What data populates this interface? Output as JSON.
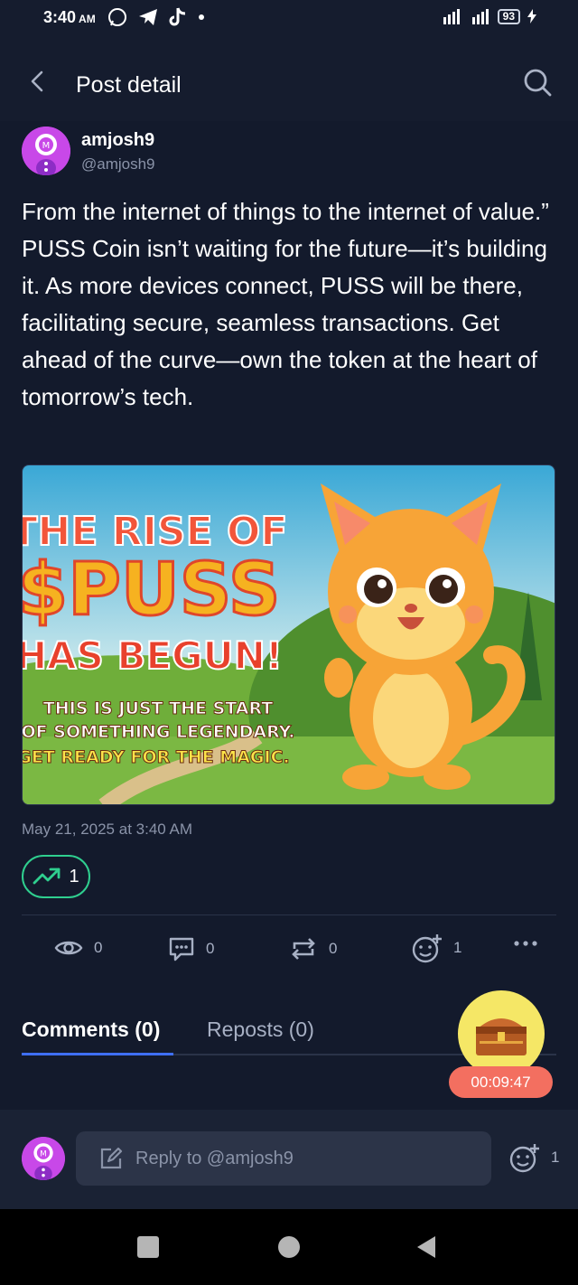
{
  "status_bar": {
    "time": "3:40",
    "ampm": "AM",
    "battery": "93",
    "network": "LTE"
  },
  "header": {
    "title": "Post detail"
  },
  "post": {
    "author_name": "amjosh9",
    "author_handle": "@amjosh9",
    "body": "From the internet of things to the internet of value.” PUSS Coin isn’t waiting for the future—it’s building it. As more devices connect, PUSS will be there, facilitating secure, seamless transactions. Get ahead of the curve—own the token at the heart of tomorrow’s tech.",
    "image": {
      "line1": "THE RISE OF",
      "line2": "$PUSS",
      "line3": "HAS BEGUN!",
      "sub1": "THIS IS JUST THE START",
      "sub2": "OF SOMETHING LEGENDARY.",
      "sub3": "GET READY FOR THE MAGIC."
    },
    "date": "May 21, 2025 at 3:40 AM",
    "trend_count": "1",
    "stats": {
      "views": "0",
      "comments": "0",
      "reposts": "0",
      "reactions": "1"
    }
  },
  "tabs": [
    {
      "label": "Comments (0)"
    },
    {
      "label": "Reposts (0)"
    }
  ],
  "reward_timer": "00:09:47",
  "reply": {
    "placeholder": "Reply to @amjosh9",
    "reaction_count": "1"
  },
  "colors": {
    "accent": "#3f6ff5",
    "trend": "#2fcf8f",
    "timer": "#f36f60",
    "chest": "#f5e766"
  }
}
